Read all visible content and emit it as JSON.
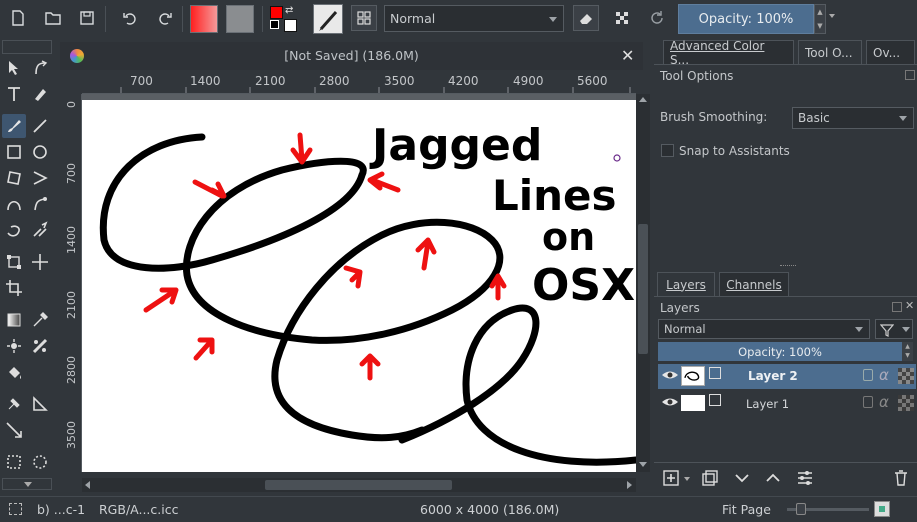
{
  "toolbar": {
    "blend_mode": "Normal",
    "opacity_label": "Opacity:  100%"
  },
  "document": {
    "title": "[Not Saved]  (186.0M)"
  },
  "ruler": {
    "h_ticks": [
      "700",
      "1400",
      "2100",
      "2800",
      "3500",
      "4200",
      "4900",
      "5600"
    ],
    "v_ticks": [
      "0",
      "700",
      "1400",
      "2100",
      "2800",
      "3500"
    ]
  },
  "docker_tabs": [
    "Advanced Color S...",
    "Tool O...",
    "Ov..."
  ],
  "tool_options": {
    "title": "Tool Options",
    "brush_smoothing_label": "Brush Smoothing:",
    "brush_smoothing_value": "Basic",
    "snap_label": "Snap to Assistants"
  },
  "layer_tabs": [
    "Layers",
    "Channels"
  ],
  "layers_panel": {
    "title": "Layers",
    "blend_mode": "Normal",
    "opacity_label": "Opacity:  100%",
    "layers": [
      {
        "name": "Layer 2",
        "selected": true
      },
      {
        "name": "Layer 1",
        "selected": false
      }
    ]
  },
  "canvas": {
    "handwriting": [
      "Jagged",
      "Lines",
      "on",
      "OSX"
    ]
  },
  "status": {
    "brush": "b) ...c-1",
    "color_space": "RGB/A...c.icc",
    "image_size": "6000 x 4000 (186.0M)",
    "zoom": "Fit Page"
  },
  "colors": {
    "accent": "#4c6d8f",
    "foreground": "#ff0000",
    "background": "#ffffff"
  }
}
